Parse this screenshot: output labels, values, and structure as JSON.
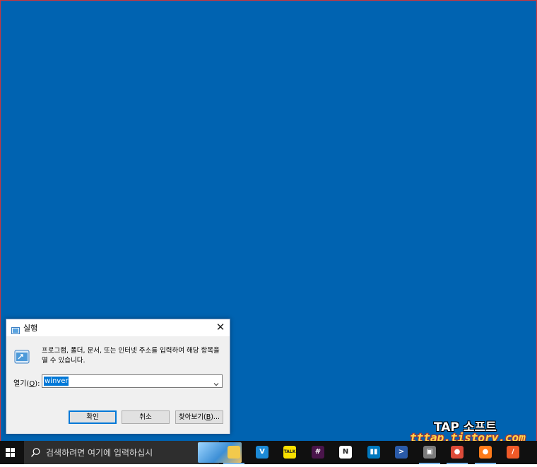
{
  "dialog": {
    "title": "실행",
    "description": "프로그램, 폴더, 문서, 또는 인터넷 주소를 입력하여 해당 항목을 열 수 있습니다.",
    "open_label_prefix": "열기(",
    "open_label_hotkey": "O",
    "open_label_suffix": "):",
    "input_value": "winver",
    "ok_label": "확인",
    "cancel_label": "취소",
    "browse_label_prefix": "찾아보기(",
    "browse_hotkey": "B",
    "browse_label_suffix": ")...",
    "close_glyph": "✕"
  },
  "watermark": {
    "title": "TAP 소프트",
    "url": "tttap.tistory.com"
  },
  "taskbar": {
    "search_placeholder": "검색하려면 여기에 입력하십시",
    "apps": [
      {
        "name": "file-explorer-icon",
        "glyph": "",
        "color": "#f2c94c"
      },
      {
        "name": "vscode-icon",
        "glyph": "V",
        "color": "#1c8ad6"
      },
      {
        "name": "kakaotalk-icon",
        "glyph": "TALK",
        "color": "#f9e000"
      },
      {
        "name": "slack-icon",
        "glyph": "#",
        "color": "#4a154b"
      },
      {
        "name": "notion-icon",
        "glyph": "N",
        "color": "#ffffff"
      },
      {
        "name": "trello-icon",
        "glyph": "▮▮",
        "color": "#0079bf"
      },
      {
        "name": "powershell-icon",
        "glyph": ">",
        "color": "#2a5aa8"
      },
      {
        "name": "remote-desktop-icon",
        "glyph": "▣",
        "color": "#7b7b7b"
      },
      {
        "name": "chrome-icon",
        "glyph": "●",
        "color": "#dd4b39"
      },
      {
        "name": "firefox-icon",
        "glyph": "●",
        "color": "#ff7b1a"
      },
      {
        "name": "brave-icon",
        "glyph": "/",
        "color": "#f05a28"
      }
    ]
  },
  "colors": {
    "desktop": "#0063b1",
    "accent": "#0078d7"
  }
}
